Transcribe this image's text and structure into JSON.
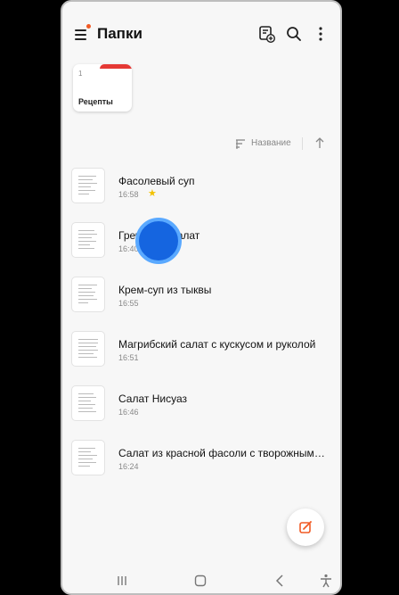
{
  "header": {
    "title": "Папки",
    "icons": [
      "menu-icon",
      "add-folder-icon",
      "search-icon",
      "more-options-icon"
    ]
  },
  "folders": [
    {
      "name": "Рецепты",
      "count": "1"
    }
  ],
  "sort": {
    "label": "Название",
    "icon": "sort-icon",
    "direction_icon": "arrow-up-icon"
  },
  "notes": [
    {
      "title": "Фасолевый суп",
      "time": "16:58",
      "starred": true
    },
    {
      "title": "Греческий салат",
      "time": "16:40",
      "starred": false
    },
    {
      "title": "Крем-суп из тыквы",
      "time": "16:55",
      "starred": false
    },
    {
      "title": "Магрибский салат с кускусом и руколой",
      "time": "16:51",
      "starred": false
    },
    {
      "title": "Салат  Нисуаз",
      "time": "16:46",
      "starred": false
    },
    {
      "title": "Салат из красной фасоли с творожным сыром",
      "time": "16:24",
      "starred": false
    }
  ],
  "fab": {
    "icon": "compose-note-icon"
  },
  "navbar": {
    "icons": [
      "recent-apps-icon",
      "home-icon",
      "back-icon",
      "accessibility-icon"
    ]
  },
  "colors": {
    "accent": "#f15a24",
    "folder_tab": "#e53935",
    "star": "#f2c200",
    "touch": "#1565e0"
  }
}
